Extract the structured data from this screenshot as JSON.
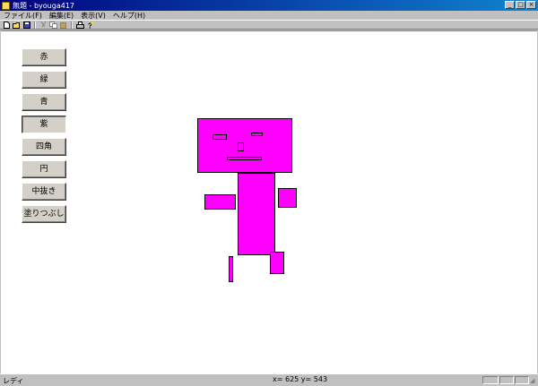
{
  "window": {
    "title": "無題 - byouga417"
  },
  "menu": [
    "ファイル(F)",
    "編集(E)",
    "表示(V)",
    "ヘルプ(H)"
  ],
  "toolbar": [
    {
      "name": "new-file-icon",
      "glyph": "🗋"
    },
    {
      "name": "open-folder-icon",
      "glyph": "📂"
    },
    {
      "name": "save-icon",
      "glyph": "💾"
    },
    {
      "name": "cut-icon",
      "glyph": "✂"
    },
    {
      "name": "copy-icon",
      "glyph": "⎘"
    },
    {
      "name": "paste-icon",
      "glyph": "📋"
    },
    {
      "name": "print-icon",
      "glyph": "🖶"
    },
    {
      "name": "help-icon",
      "glyph": "?"
    }
  ],
  "buttons": [
    "赤",
    "緑",
    "青",
    "紫",
    "四角",
    "円",
    "中抜き",
    "塗りつぶし"
  ],
  "coords": "x= 625 y= 543",
  "status": {
    "text": "レディ"
  },
  "colors": {
    "fill": "#ff00ff",
    "canvas": "#ffffff",
    "chrome": "#c0c0c0"
  }
}
